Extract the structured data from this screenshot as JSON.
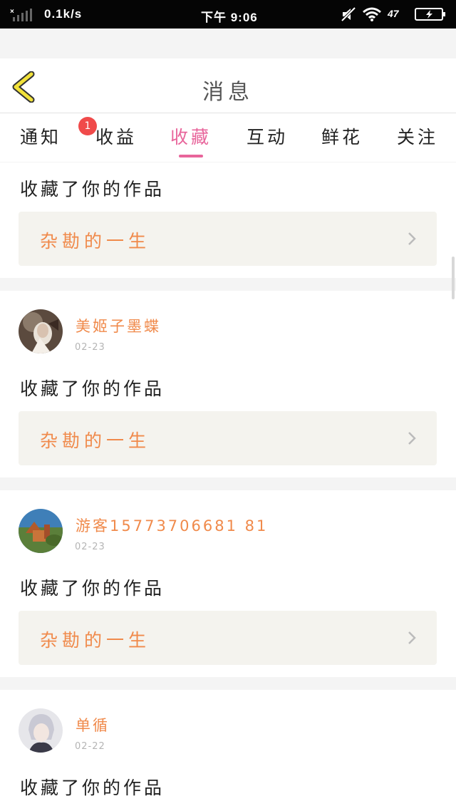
{
  "status_bar": {
    "speed": "0.1k/s",
    "time": "下午 9:06",
    "battery_percent": "47"
  },
  "header": {
    "title": "消息",
    "back_icon": "chevron-left-icon"
  },
  "tabs": [
    {
      "label": "通知",
      "badge": "1",
      "active": false
    },
    {
      "label": "收益",
      "active": false
    },
    {
      "label": "收藏",
      "active": true
    },
    {
      "label": "互动",
      "active": false
    },
    {
      "label": "鲜花",
      "active": false
    },
    {
      "label": "关注",
      "active": false
    }
  ],
  "feed": {
    "first_action": "收藏了你的作品",
    "first_work_title": "杂勘的一生",
    "items": [
      {
        "username": "美姬子墨蝶",
        "date": "02-23",
        "action": "收藏了你的作品",
        "work_title": "杂勘的一生"
      },
      {
        "username": "游客15773706681 81",
        "date": "02-23",
        "action": "收藏了你的作品",
        "work_title": "杂勘的一生"
      },
      {
        "username": "单循",
        "date": "02-22",
        "action": "收藏了你的作品"
      }
    ]
  },
  "colors": {
    "accent_pink": "#e8659b",
    "username_orange": "#f08a4b",
    "badge_red": "#f04a4a",
    "work_box_bg": "#f4f3ee",
    "back_arrow_yellow": "#f2e23a"
  }
}
